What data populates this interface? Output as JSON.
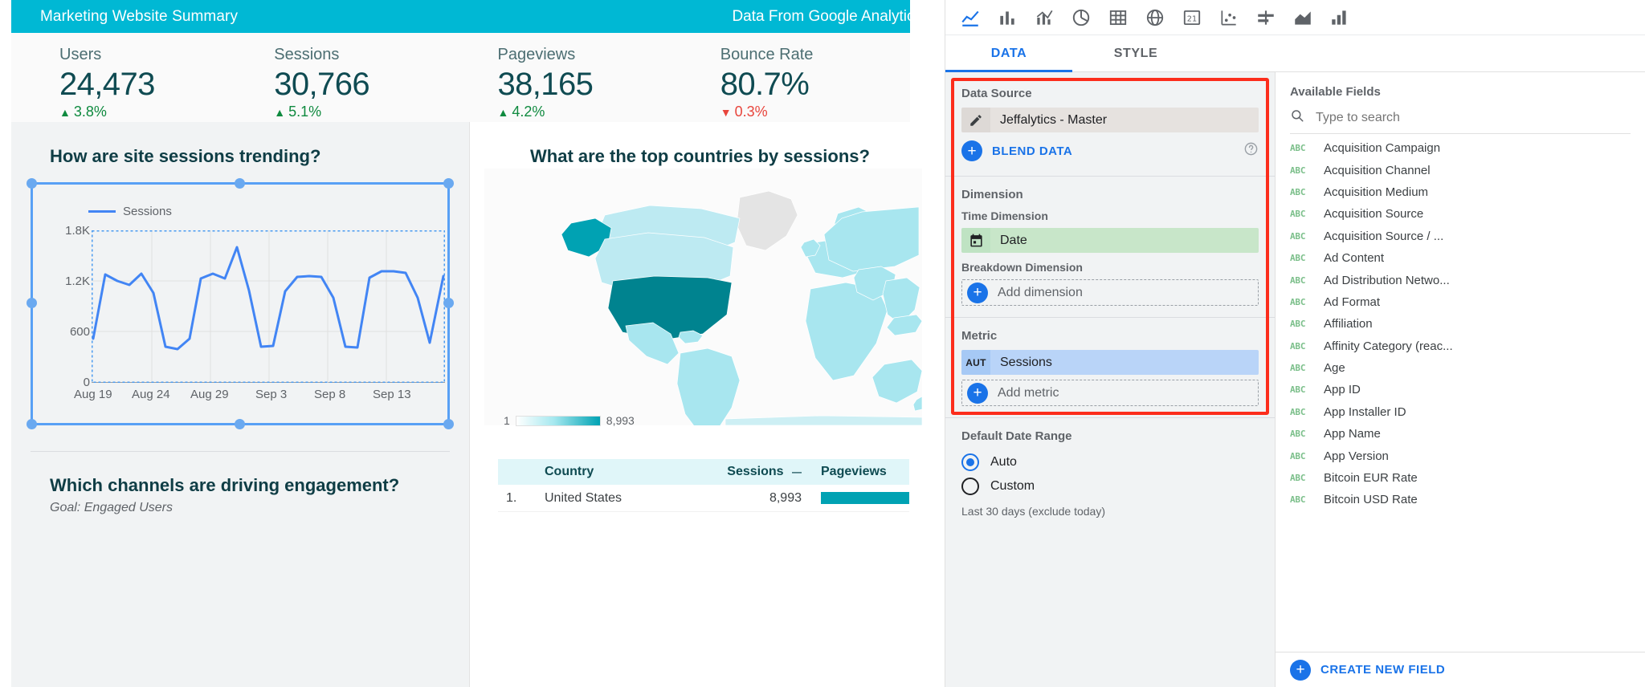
{
  "report": {
    "title": "Marketing Website Summary",
    "subtitle": "Data From Google Analytics",
    "header_color": "#00b8d4",
    "scorecards": [
      {
        "label": "Users",
        "value": "24,473",
        "delta": "3.8%",
        "direction": "up",
        "arrow": "▲"
      },
      {
        "label": "Sessions",
        "value": "30,766",
        "delta": "5.1%",
        "direction": "up",
        "arrow": "▲"
      },
      {
        "label": "Pageviews",
        "value": "38,165",
        "delta": "4.2%",
        "direction": "up",
        "arrow": "▲"
      },
      {
        "label": "Bounce Rate",
        "value": "80.7%",
        "delta": "0.3%",
        "direction": "down",
        "arrow": "▼"
      }
    ],
    "left_panel": {
      "question": "How are site sessions trending?",
      "second_question": "Which channels are driving engagement?",
      "second_goal": "Goal: Engaged Users"
    },
    "right_panel": {
      "question": "What are the top countries by sessions?",
      "map_legend_min": "1",
      "map_legend_max": "8,993",
      "table": {
        "columns": [
          "Country",
          "Sessions",
          "Pageviews"
        ],
        "sort_indicator": "—",
        "rows": [
          {
            "rank": "1.",
            "country": "United States",
            "sessions": "8,993",
            "pageviews_bar_pct": 100
          }
        ]
      }
    }
  },
  "chart_data": {
    "type": "line",
    "title": "How are site sessions trending?",
    "legend": [
      "Sessions"
    ],
    "legend_position": "top-left",
    "series": [
      {
        "name": "Sessions",
        "values": [
          520,
          1280,
          1200,
          1150,
          1300,
          1060,
          430,
          400,
          520,
          1230,
          1290,
          1230,
          1600,
          1090,
          430,
          440,
          1080,
          1250,
          1260,
          1250,
          1000,
          430,
          420,
          1240,
          1320,
          1320,
          1300,
          1000,
          470,
          1260
        ]
      }
    ],
    "x": [
      "Aug 19",
      "Aug 20",
      "Aug 21",
      "Aug 22",
      "Aug 23",
      "Aug 24",
      "Aug 25",
      "Aug 26",
      "Aug 27",
      "Aug 28",
      "Aug 29",
      "Aug 30",
      "Aug 31",
      "Sep 1",
      "Sep 2",
      "Sep 3",
      "Sep 4",
      "Sep 5",
      "Sep 6",
      "Sep 7",
      "Sep 8",
      "Sep 9",
      "Sep 10",
      "Sep 11",
      "Sep 12",
      "Sep 13",
      "Sep 14",
      "Sep 15",
      "Sep 16",
      "Sep 17"
    ],
    "xticks": [
      "Aug 19",
      "Aug 24",
      "Aug 29",
      "Sep 3",
      "Sep 8",
      "Sep 13"
    ],
    "yticks": [
      "1.8K",
      "1.2K",
      "600",
      "0"
    ],
    "ylim": [
      0,
      1800
    ],
    "xlabel": "",
    "ylabel": "",
    "grid": true,
    "line_color": "#4285f4"
  },
  "inspector": {
    "viz_icons": [
      "line-chart-icon",
      "bar-chart-icon",
      "combo-chart-icon",
      "pie-chart-icon",
      "table-icon",
      "geo-map-icon",
      "scorecard-icon",
      "scatter-chart-icon",
      "bullet-chart-icon",
      "area-chart-icon",
      "pivot-table-icon"
    ],
    "tabs": [
      {
        "label": "DATA",
        "active": true
      },
      {
        "label": "STYLE",
        "active": false
      }
    ],
    "properties": {
      "data_source": {
        "title": "Data Source",
        "source_name": "Jeffalytics - Master",
        "source_icon": "pencil-icon",
        "blend_label": "BLEND DATA",
        "help_icon": "help-circle-icon"
      },
      "dimension": {
        "title": "Dimension",
        "time_dimension_label": "Time Dimension",
        "time_dimension_value": "Date",
        "time_dimension_icon": "calendar-icon",
        "breakdown_label": "Breakdown Dimension",
        "add_dimension_label": "Add dimension"
      },
      "metric": {
        "title": "Metric",
        "badge": "AUT",
        "value": "Sessions",
        "add_metric_label": "Add metric"
      },
      "default_date_range": {
        "title": "Default Date Range",
        "options": [
          {
            "label": "Auto",
            "selected": true
          },
          {
            "label": "Custom",
            "selected": false
          }
        ],
        "note": "Last 30 days (exclude today)"
      },
      "highlight_color": "#fc2d1c"
    },
    "available_fields": {
      "title": "Available Fields",
      "search_placeholder": "Type to search",
      "search_value": "",
      "search_icon": "search-icon",
      "fields": [
        {
          "type": "ABC",
          "name": "Acquisition Campaign"
        },
        {
          "type": "ABC",
          "name": "Acquisition Channel"
        },
        {
          "type": "ABC",
          "name": "Acquisition Medium"
        },
        {
          "type": "ABC",
          "name": "Acquisition Source"
        },
        {
          "type": "ABC",
          "name": "Acquisition Source / ..."
        },
        {
          "type": "ABC",
          "name": "Ad Content"
        },
        {
          "type": "ABC",
          "name": "Ad Distribution Netwo..."
        },
        {
          "type": "ABC",
          "name": "Ad Format"
        },
        {
          "type": "ABC",
          "name": "Affiliation"
        },
        {
          "type": "ABC",
          "name": "Affinity Category (reac..."
        },
        {
          "type": "ABC",
          "name": "Age"
        },
        {
          "type": "ABC",
          "name": "App ID"
        },
        {
          "type": "ABC",
          "name": "App Installer ID"
        },
        {
          "type": "ABC",
          "name": "App Name"
        },
        {
          "type": "ABC",
          "name": "App Version"
        },
        {
          "type": "ABC",
          "name": "Bitcoin EUR Rate"
        },
        {
          "type": "ABC",
          "name": "Bitcoin USD Rate"
        }
      ],
      "create_new_field_label": "CREATE NEW FIELD",
      "create_icon": "plus-icon"
    }
  }
}
